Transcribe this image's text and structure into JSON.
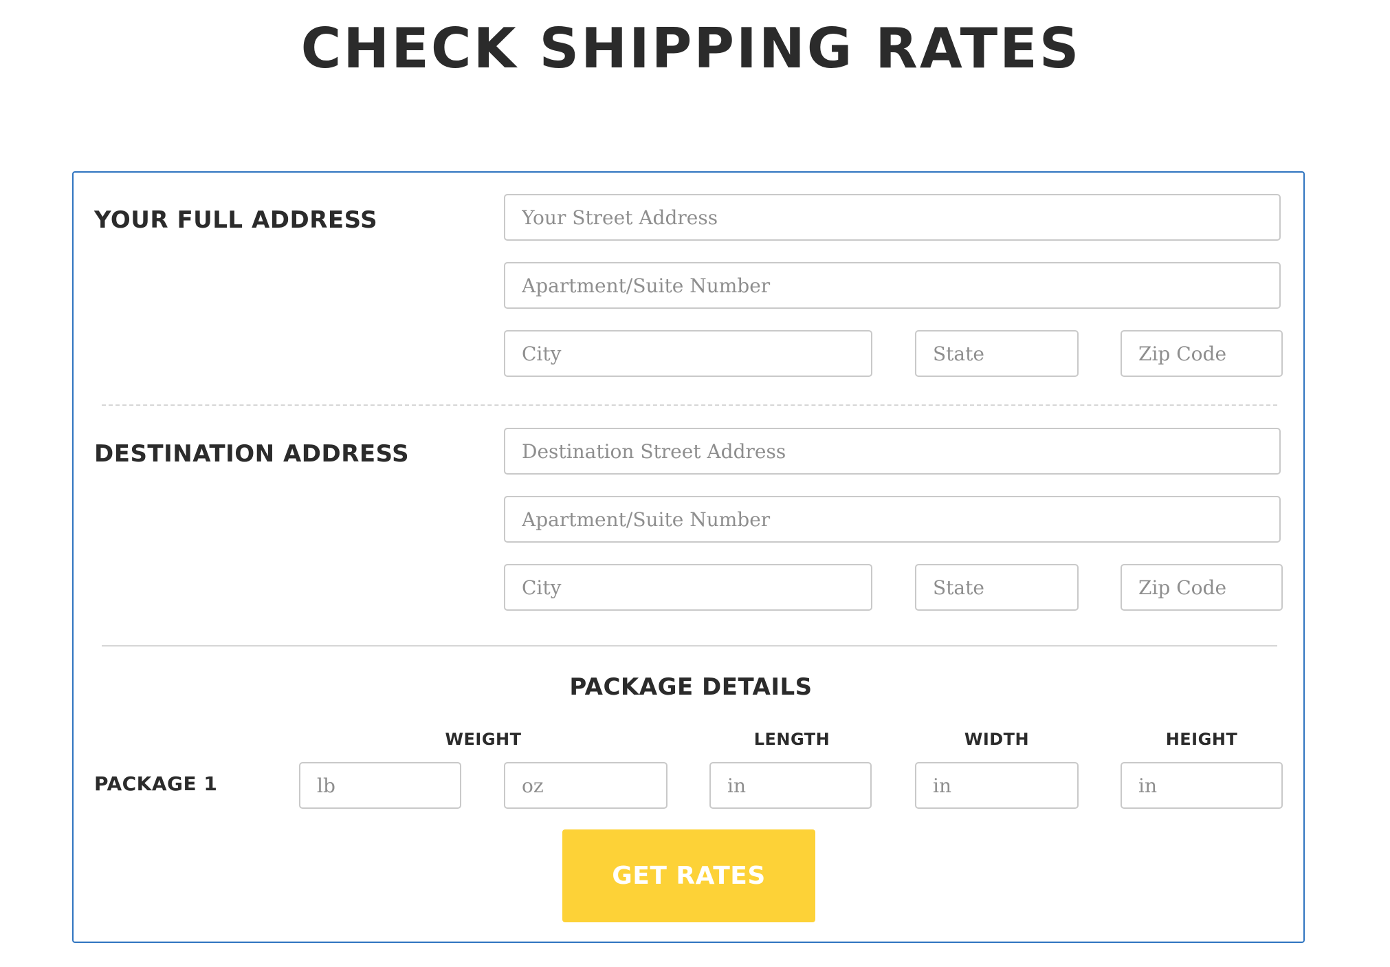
{
  "page": {
    "title": "CHECK SHIPPING RATES"
  },
  "your_address": {
    "label": "YOUR FULL ADDRESS",
    "street_placeholder": "Your Street Address",
    "apartment_placeholder": "Apartment/Suite Number",
    "city_placeholder": "City",
    "state_placeholder": "State",
    "zip_placeholder": "Zip Code"
  },
  "destination_address": {
    "label": "DESTINATION ADDRESS",
    "street_placeholder": "Destination Street Address",
    "apartment_placeholder": "Apartment/Suite Number",
    "city_placeholder": "City",
    "state_placeholder": "State",
    "zip_placeholder": "Zip Code"
  },
  "package_details": {
    "heading": "PACKAGE DETAILS",
    "columns": {
      "weight": "WEIGHT",
      "length": "LENGTH",
      "width": "WIDTH",
      "height": "HEIGHT"
    },
    "package_label": "PACKAGE 1",
    "weight_lb_placeholder": "lb",
    "weight_oz_placeholder": "oz",
    "length_placeholder": "in",
    "width_placeholder": "in",
    "height_placeholder": "in"
  },
  "actions": {
    "submit_label": "GET RATES",
    "submit_color": "#fdd237"
  },
  "colors": {
    "panel_border": "#2f74c0",
    "heading_text": "#2b2b2b",
    "field_border": "#c9c9c9",
    "placeholder_text": "#8e8e8e"
  }
}
